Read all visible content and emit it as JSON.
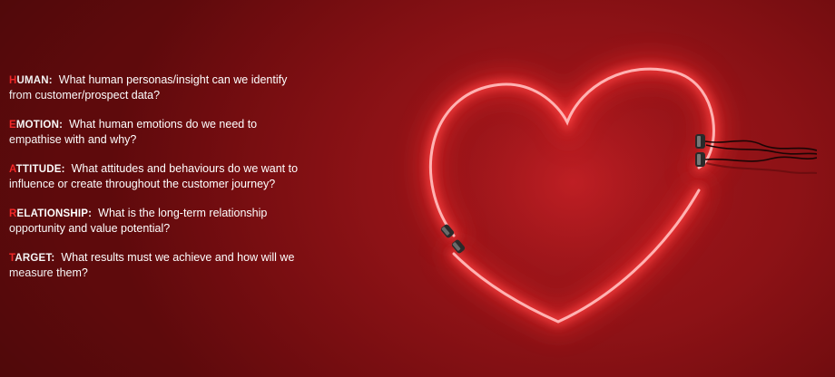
{
  "items": [
    {
      "initial": "H",
      "rest": "UMAN:",
      "question": "What human personas/insight can we identify from customer/prospect data?"
    },
    {
      "initial": "E",
      "rest": "MOTION:",
      "question": "What human emotions do we need to empathise with and why?"
    },
    {
      "initial": "A",
      "rest": "TTITUDE:",
      "question": "What attitudes and behaviours do we want to influence or create throughout the customer journey?"
    },
    {
      "initial": "R",
      "rest": "ELATIONSHIP:",
      "question": "What is the long-term relationship opportunity and value potential?"
    },
    {
      "initial": "T",
      "rest": "ARGET:",
      "question": "What results must we achieve and how will we measure them?"
    }
  ],
  "colors": {
    "background": "#8d1216",
    "accent": "#ff2a2a",
    "text": "#ffffff",
    "neon": "#ff3b3b"
  },
  "image": {
    "subject": "neon-heart"
  }
}
